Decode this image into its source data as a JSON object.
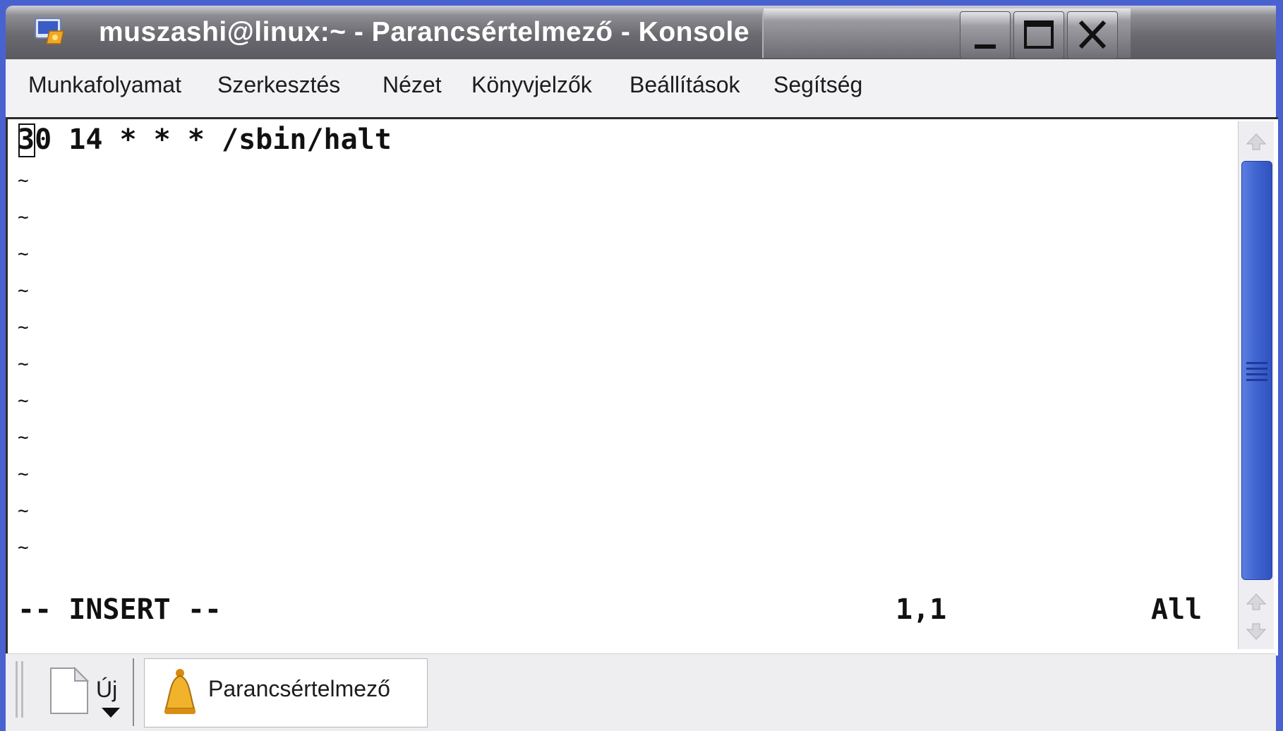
{
  "window": {
    "title": "muszashi@linux:~ - Parancsértelmező - Konsole"
  },
  "menubar": {
    "items": [
      "Munkafolyamat",
      "Szerkesztés",
      "Nézet",
      "Könyvjelzők",
      "Beállítások",
      "Segítség"
    ]
  },
  "terminal": {
    "first_char": "3",
    "content_rest": "0 14 * * * /sbin/halt",
    "tilde": "~",
    "status_mode": "-- INSERT --",
    "status_position": "1,1",
    "status_range": "All"
  },
  "tabbar": {
    "new_label": "Új",
    "tab_label": "Parancsértelmező"
  },
  "colors": {
    "desktop": "#4a62d0",
    "scroll_thumb": "#3f63cf",
    "title_text": "#ffffff"
  },
  "icons": [
    "konsole-app-icon",
    "minimize-icon",
    "maximize-icon",
    "close-icon",
    "new-session-icon",
    "dropdown-arrow-icon",
    "shell-bell-icon",
    "scroll-up-icon",
    "scroll-down-icon"
  ]
}
